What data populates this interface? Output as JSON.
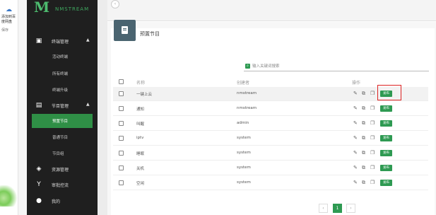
{
  "browser_strip": {
    "label1": "添加到百",
    "label2": "度网盘",
    "label3": "保存"
  },
  "logo": {
    "mark": "M",
    "cn": "NMSTREAM",
    "en": ""
  },
  "sidebar": {
    "terminal_mgmt": "终端管理",
    "active_terminals": "活动终端",
    "all_terminals": "所有终端",
    "terminal_upgrade": "终端升级",
    "program_mgmt": "节目管理",
    "preset_programs": "预置节目",
    "normal_programs": "普通节目",
    "program_groups": "节目组",
    "resource_mgmt": "资源管理",
    "approval_flow": "审批控流",
    "mine": "我的"
  },
  "panel": {
    "title": "预置节目"
  },
  "search": {
    "placeholder": "输入关键词搜索"
  },
  "table": {
    "headers": {
      "name": "名称",
      "creator": "创建者",
      "ops": "操作"
    },
    "publish_label": "发布",
    "rows": [
      {
        "name": "一键上云",
        "creator": "nmstream"
      },
      {
        "name": "通知",
        "creator": "nmstream"
      },
      {
        "name": "叫醒",
        "creator": "admin"
      },
      {
        "name": "iptv",
        "creator": "system"
      },
      {
        "name": "睡眠",
        "creator": "system"
      },
      {
        "name": "关机",
        "creator": "system"
      },
      {
        "name": "空闲",
        "creator": "system"
      }
    ]
  },
  "pagination": {
    "prev": "‹",
    "current": "1",
    "next": "›"
  },
  "colors": {
    "sidebar_bg": "#1f1f1f",
    "accent_green": "#2e9a52",
    "highlight_red": "#dd2222"
  },
  "icons": [
    "cloud-icon",
    "clipboard-icon",
    "screen-icon",
    "resource-icon",
    "flow-icon",
    "user-icon",
    "search-icon",
    "edit-icon",
    "copy-icon",
    "duplicate-icon"
  ]
}
